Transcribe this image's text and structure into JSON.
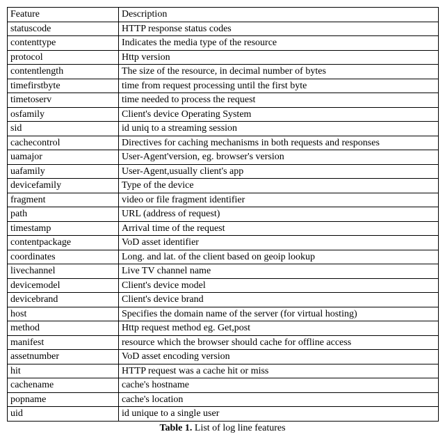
{
  "table": {
    "header": {
      "feature": "Feature",
      "description": "Description"
    },
    "rows": [
      {
        "feature": "statuscode",
        "description": "HTTP response status codes"
      },
      {
        "feature": "contenttype",
        "description": "Indicates the media type of the resource"
      },
      {
        "feature": "protocol",
        "description": "Http version"
      },
      {
        "feature": "contentlength",
        "description": "The size of the resource, in decimal number of bytes"
      },
      {
        "feature": "timefirstbyte",
        "description": "time from request processing until the first byte"
      },
      {
        "feature": "timetoserv",
        "description": "time needed to process the request"
      },
      {
        "feature": "osfamily",
        "description": "Client's device Operating System"
      },
      {
        "feature": "sid",
        "description": "id uniq to a streaming session"
      },
      {
        "feature": "cachecontrol",
        "description": "Directives for caching mechanisms in both requests and responses"
      },
      {
        "feature": "uamajor",
        "description": "User-Agent'version, eg. browser's version"
      },
      {
        "feature": "uafamily",
        "description": "User-Agent,usually client's app"
      },
      {
        "feature": "devicefamily",
        "description": "Type of the device"
      },
      {
        "feature": "fragment",
        "description": "video or file fragment identifier"
      },
      {
        "feature": "path",
        "description": "URL (address of request)"
      },
      {
        "feature": "timestamp",
        "description": "Arrival time of the request"
      },
      {
        "feature": "contentpackage",
        "description": "VoD asset identifier"
      },
      {
        "feature": "coordinates",
        "description": "Long. and lat. of the client based on geoip lookup"
      },
      {
        "feature": "livechannel",
        "description": "Live TV channel name"
      },
      {
        "feature": "devicemodel",
        "description": "Client's device model"
      },
      {
        "feature": "devicebrand",
        "description": "Client's device brand"
      },
      {
        "feature": "host",
        "description": "Specifies the domain name of the server (for virtual hosting)"
      },
      {
        "feature": "method",
        "description": "Http request method eg. Get,post"
      },
      {
        "feature": "manifest",
        "description": "resource which the browser should cache for offline access"
      },
      {
        "feature": "assetnumber",
        "description": "VoD asset encoding version"
      },
      {
        "feature": "hit",
        "description": "HTTP request was a cache hit or miss"
      },
      {
        "feature": "cachename",
        "description": "cache's hostname"
      },
      {
        "feature": "popname",
        "description": "cache's location"
      },
      {
        "feature": "uid",
        "description": "id unique to a single user"
      }
    ]
  },
  "caption": {
    "label": "Table 1.",
    "text": "List of log line features"
  }
}
